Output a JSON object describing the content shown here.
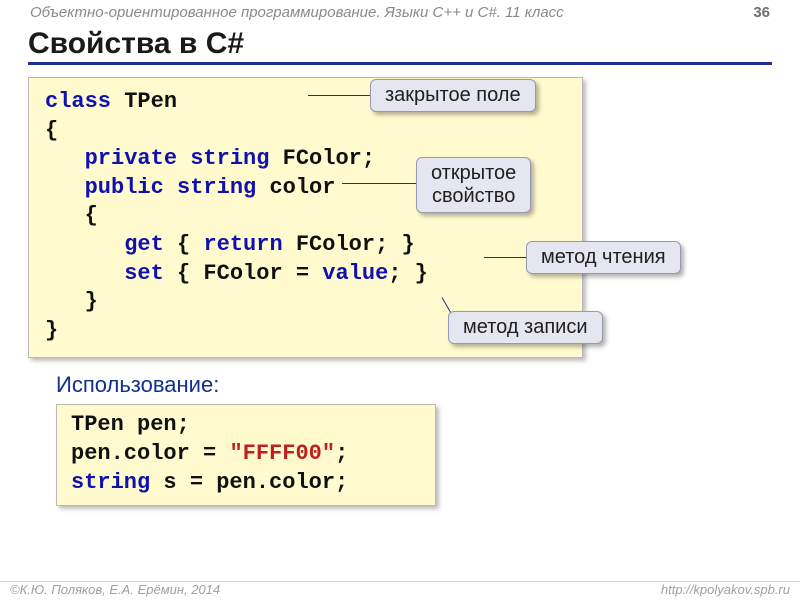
{
  "header": {
    "course": "Объектно-ориентированное программирование. Языки C++ и C#. 11 класс",
    "page": "36"
  },
  "title": "Свойства в C#",
  "code1": {
    "l1a": "class",
    "l1b": " TPen",
    "l2": "{",
    "l3a": "   private",
    "l3b": " string",
    "l3c": " FColor;",
    "l4a": "   public",
    "l4b": " string",
    "l4c": " color",
    "l5": "   {",
    "l6a": "      get",
    "l6b": " { ",
    "l6c": "return",
    "l6d": " FColor; }",
    "l7a": "      set",
    "l7b": " { FColor = ",
    "l7c": "value",
    "l7d": "; }",
    "l8": "   }",
    "l9": "}"
  },
  "callouts": {
    "c1": "закрытое поле",
    "c2a": "открытое",
    "c2b": "свойство",
    "c3": "метод чтения",
    "c4": "метод записи"
  },
  "usage_label": "Использование:",
  "code2": {
    "l1": "TPen pen;",
    "l2a": "pen.color = ",
    "l2b": "\"FFFF00\"",
    "l2c": ";",
    "l3a": "string",
    "l3b": " s = pen.color;"
  },
  "footer": {
    "left": "©К.Ю. Поляков, Е.А. Ерёмин, 2014",
    "right": "http://kpolyakov.spb.ru"
  }
}
